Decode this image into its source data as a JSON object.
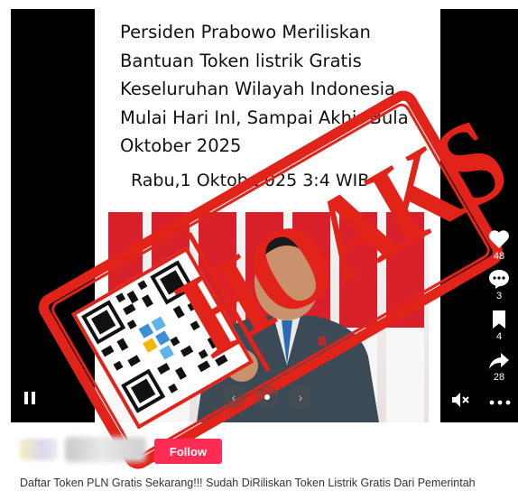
{
  "post": {
    "headline_lines": [
      "Persiden Prabowo Meriliskan",
      "Bantuan Token listrik Gratis",
      "Keseluruhan Wilayah Indonesia",
      "Mulai Hari InI, Sampai Akhir Bula",
      "Oktober 2025"
    ],
    "dateline": "Rabu,1 Oktob    2025   3:4   WIB"
  },
  "stamp": {
    "text": "HOAKS",
    "color": "#e2231a"
  },
  "actions": {
    "likes": "48",
    "comments": "3",
    "bookmarks": "4",
    "shares": "28"
  },
  "follow_label": "Follow",
  "caption": "Daftar Token PLN Gratis Sekarang!!! Sudah DiRiliskan Token Listrik Gratis Dari Pemerintah",
  "colors": {
    "accent": "#fe2c55",
    "stamp": "#e2231a",
    "video_bg": "#000000"
  }
}
